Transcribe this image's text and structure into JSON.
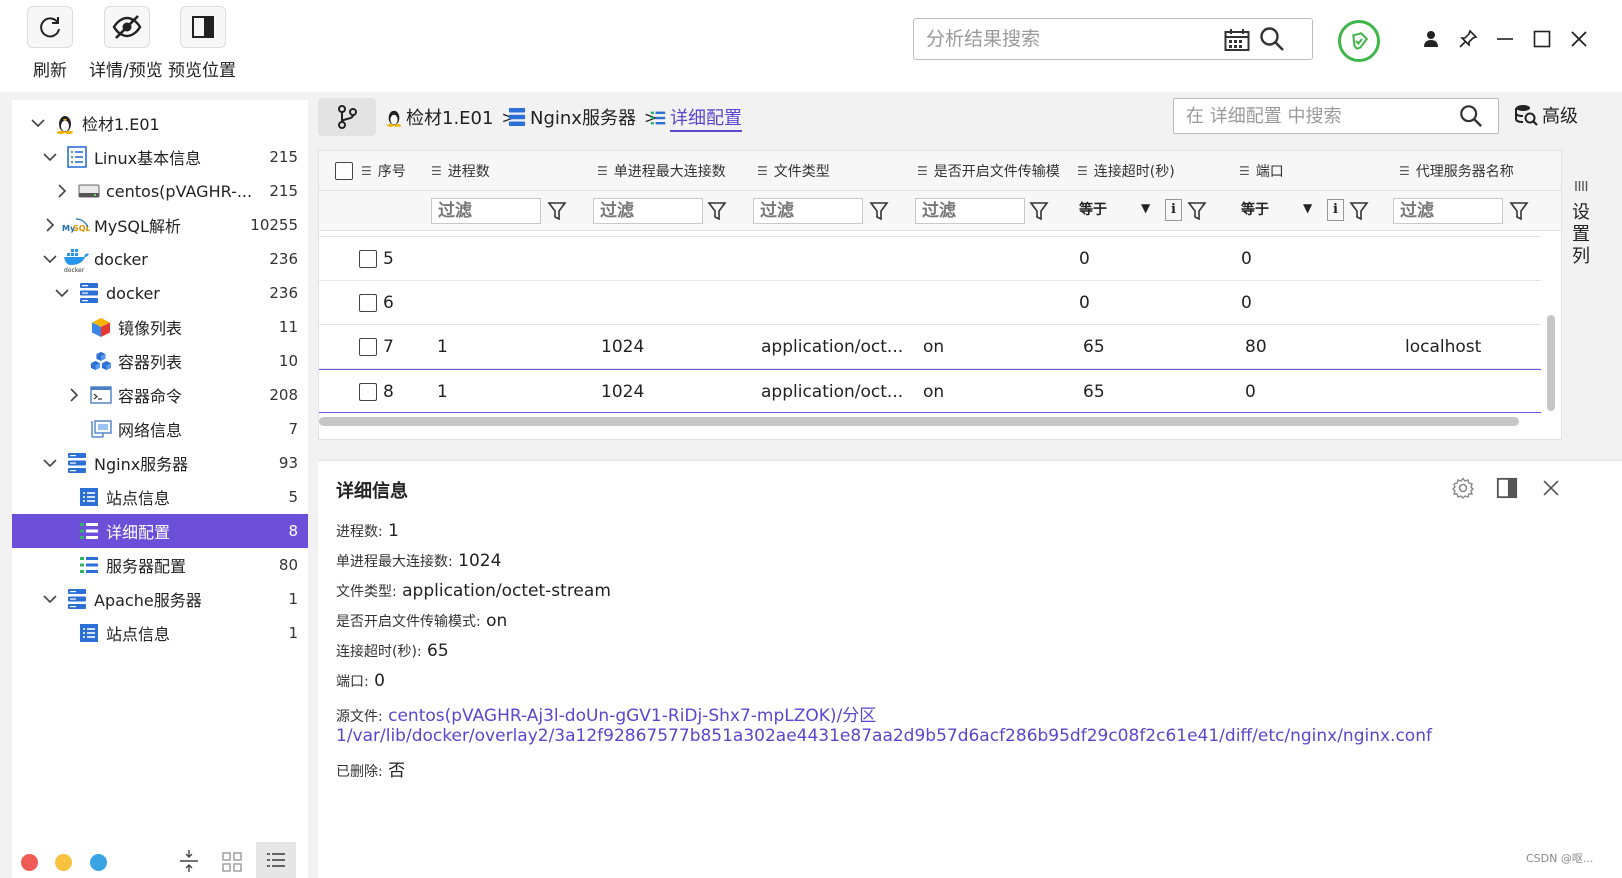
{
  "toolbar": {
    "refresh_label": "刷新",
    "details_label": "详情/预览",
    "preview_pos_label": "预览位置"
  },
  "top_search": {
    "placeholder": "分析结果搜索"
  },
  "tree": [
    {
      "label": "检材1.E01",
      "count": "",
      "icon": "linux-penguin-icon"
    },
    {
      "label": "Linux基本信息",
      "count": "215",
      "icon": "list-doc-icon"
    },
    {
      "label": "centos(pVAGHR-...",
      "count": "215",
      "icon": "drive-icon"
    },
    {
      "label": "MySQL解析",
      "count": "10255",
      "icon": "mysql-icon"
    },
    {
      "label": "docker",
      "count": "236",
      "icon": "docker-icon"
    },
    {
      "label": "docker",
      "count": "236",
      "icon": "server-icon"
    },
    {
      "label": "镜像列表",
      "count": "11",
      "icon": "cube-icon"
    },
    {
      "label": "容器列表",
      "count": "10",
      "icon": "cubes-icon"
    },
    {
      "label": "容器命令",
      "count": "208",
      "icon": "terminal-icon"
    },
    {
      "label": "网络信息",
      "count": "7",
      "icon": "network-icon"
    },
    {
      "label": "Nginx服务器",
      "count": "93",
      "icon": "server-icon"
    },
    {
      "label": "站点信息",
      "count": "5",
      "icon": "list-icon"
    },
    {
      "label": "详细配置",
      "count": "8",
      "icon": "list-green-icon"
    },
    {
      "label": "服务器配置",
      "count": "80",
      "icon": "list-green-icon"
    },
    {
      "label": "Apache服务器",
      "count": "1",
      "icon": "server-icon"
    },
    {
      "label": "站点信息",
      "count": "1",
      "icon": "list-icon"
    }
  ],
  "breadcrumb": {
    "root": "检材1.E01",
    "mid": "Nginx服务器",
    "current": "详细配置",
    "sep": ">"
  },
  "crumb_search": {
    "placeholder": "在 详细配置 中搜索"
  },
  "advanced_label": "高级",
  "table": {
    "headers": [
      "序号",
      "进程数",
      "单进程最大连接数",
      "文件类型",
      "是否开启文件传输模",
      "连接超时(秒)",
      "端口",
      "代理服务器名称"
    ],
    "filter_placeholder": "过滤",
    "equals_label": "等于",
    "info_glyph": "i",
    "rows": [
      {
        "id": "5",
        "proc": "",
        "maxconn": "",
        "ftype": "",
        "sendfile": "",
        "timeout": "0",
        "port": "0",
        "proxy": ""
      },
      {
        "id": "6",
        "proc": "",
        "maxconn": "",
        "ftype": "",
        "sendfile": "",
        "timeout": "0",
        "port": "0",
        "proxy": ""
      },
      {
        "id": "7",
        "proc": "1",
        "maxconn": "1024",
        "ftype": "application/oct...",
        "sendfile": "on",
        "timeout": "65",
        "port": "80",
        "proxy": "localhost"
      },
      {
        "id": "8",
        "proc": "1",
        "maxconn": "1024",
        "ftype": "application/oct...",
        "sendfile": "on",
        "timeout": "65",
        "port": "0",
        "proxy": ""
      }
    ]
  },
  "set_columns_label": [
    "设",
    "置",
    "列"
  ],
  "detail": {
    "title": "详细信息",
    "fields": [
      {
        "k": "进程数:",
        "v": "1"
      },
      {
        "k": "单进程最大连接数:",
        "v": "1024"
      },
      {
        "k": "文件类型:",
        "v": "application/octet-stream"
      },
      {
        "k": "是否开启文件传输模式:",
        "v": "on"
      },
      {
        "k": "连接超时(秒):",
        "v": "65"
      },
      {
        "k": "端口:",
        "v": "0"
      }
    ],
    "source_key": "源文件:",
    "source_line1": "centos(pVAGHR-Aj3l-doUn-gGV1-RiDj-Shx7-mpLZOK)/分区",
    "source_line2": "1/var/lib/docker/overlay2/3a12f92867577b851a302ae4431e87aa2d9b57d6acf286b95df29c08f2c61e41/diff/etc/nginx/nginx.conf",
    "deleted_key": "已删除:",
    "deleted_val": "否"
  },
  "watermark": "CSDN @呕...",
  "colors": {
    "accent": "#6b4fd8",
    "link": "#5b46d0",
    "green": "#3fb54a"
  }
}
